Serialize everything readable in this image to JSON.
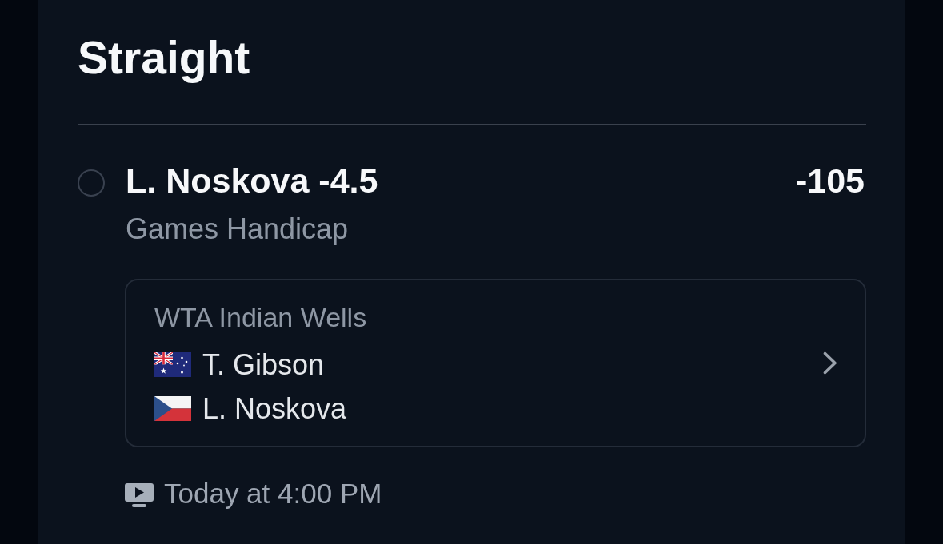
{
  "section": {
    "title": "Straight"
  },
  "selection": {
    "selected": false,
    "label": "L. Noskova -4.5",
    "odds": "-105",
    "market": "Games Handicap"
  },
  "event": {
    "league": "WTA Indian Wells",
    "players": [
      {
        "name": "T. Gibson",
        "kind": "australia"
      },
      {
        "name": "L. Noskova",
        "kind": "czechia"
      }
    ]
  },
  "start": {
    "time": "Today at 4:00 PM"
  }
}
